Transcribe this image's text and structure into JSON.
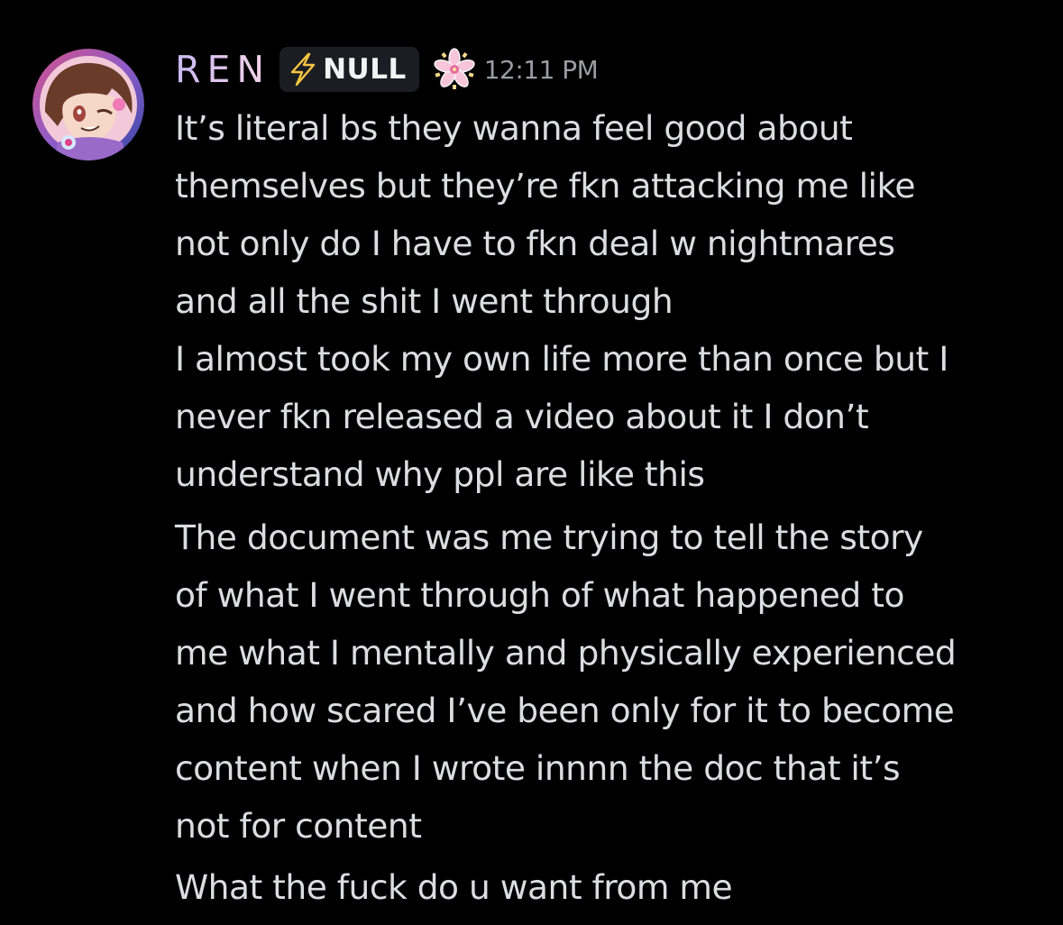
{
  "message": {
    "author": {
      "display_name": "REN",
      "name_gradient": [
        "#c7b8ee",
        "#f3d4e6"
      ],
      "avatar_icon": "anime-avatar-icon",
      "clan_tag": {
        "icon": "lightning-bolt-icon",
        "icon_color": "#f5c542",
        "label": "NULL"
      },
      "role_icon": "cherry-blossom-icon"
    },
    "timestamp": "12:11 PM",
    "blocks": [
      {
        "lines": [
          "It’s literal bs they wanna feel good about",
          "themselves but they’re fkn attacking me like",
          "not only do I have to fkn deal w nightmares",
          "and all the shit I went through",
          "I almost took my own life more than once but I",
          "never fkn released a video about it I don’t",
          "understand why ppl are like this"
        ]
      },
      {
        "lines": [
          "The document was me trying to tell the story",
          "of what I went through of what happened to",
          "me what I mentally and physically experienced",
          "and how scared I’ve been only for it to become",
          "content when I wrote innnn the doc that it’s",
          "not for content"
        ]
      },
      {
        "lines": [
          "What the fuck do u want from me"
        ]
      }
    ]
  },
  "colors": {
    "background": "#000000",
    "text": "#dcdde1",
    "timestamp": "#9a9ca3",
    "clan_tag_bg": "#1c1d22"
  }
}
